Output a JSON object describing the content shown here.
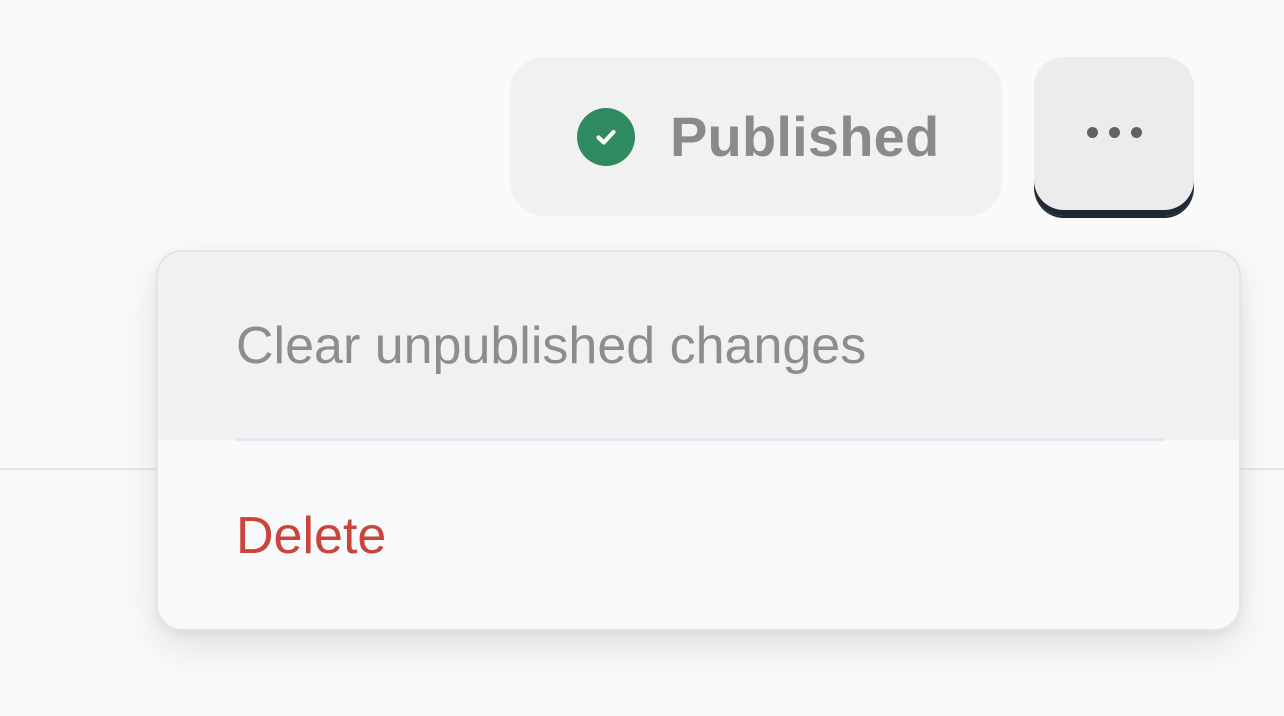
{
  "status": {
    "label": "Published",
    "icon": "check-circle-icon",
    "icon_color": "#2f8a61"
  },
  "more_button": {
    "icon": "more-horizontal-icon"
  },
  "menu": {
    "items": [
      {
        "label": "Clear unpublished changes",
        "state": "hovered"
      },
      {
        "label": "Delete",
        "color": "#c9443a"
      }
    ]
  }
}
